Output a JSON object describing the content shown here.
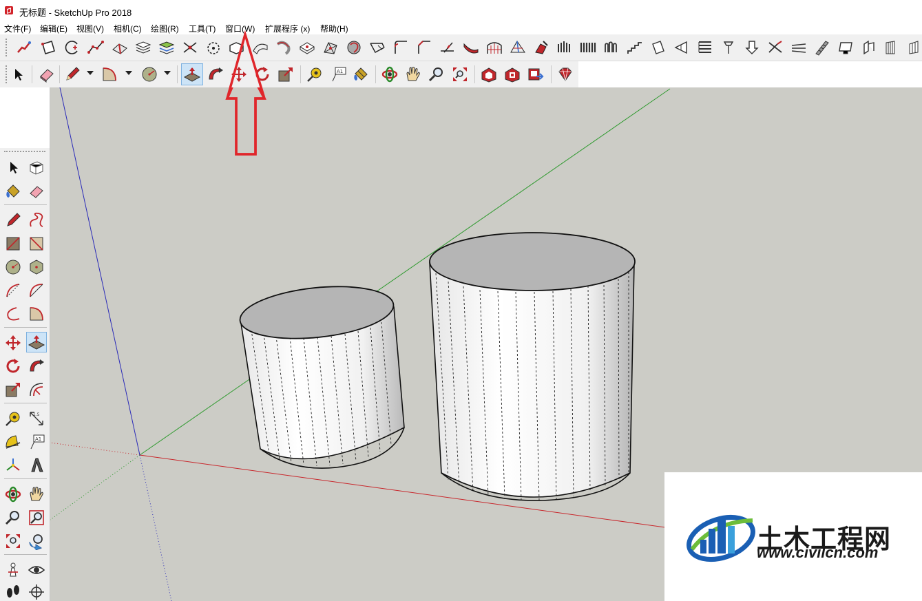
{
  "window": {
    "title": "无标题 - SketchUp Pro 2018",
    "logo_icon": "sketchup-logo-icon"
  },
  "menu": {
    "items": [
      {
        "label": "文件(F)"
      },
      {
        "label": "编辑(E)"
      },
      {
        "label": "视图(V)"
      },
      {
        "label": "相机(C)"
      },
      {
        "label": "绘图(R)"
      },
      {
        "label": "工具(T)"
      },
      {
        "label": "窗口(W)"
      },
      {
        "label": "扩展程序 (x)"
      },
      {
        "label": "帮助(H)"
      }
    ]
  },
  "toolbars": {
    "top_row_icons": [
      "freehand-tool-icon",
      "polygon-tool-icon",
      "circle-plus-icon",
      "polyline-icon",
      "sandbox-icon",
      "layers-icon",
      "layer-manager-icon",
      "intersect-icon",
      "rotate-icon",
      "shape-icon",
      "bend-icon",
      "twist-icon",
      "extrude-icon",
      "subdivide-icon",
      "fillet-icon",
      "round-corner-icon",
      "split-icon",
      "chamfer-icon",
      "curve-icon",
      "pipe-icon",
      "bridge-icon",
      "loft-icon",
      "sweep-icon",
      "face-icon",
      "wall-icon",
      "column-icon",
      "stair-icon",
      "grid-icon",
      "rail-icon",
      "arch-icon",
      "flip-icon",
      "stack-icon",
      "peg-icon",
      "push-icon",
      "trim-icon",
      "extend-icon",
      "roof-icon",
      "cube-icon",
      "tag-icon",
      "ruler-icon"
    ],
    "second_row_icons": [
      "select-icon",
      "eraser-icon",
      "pencil-icon",
      "arc-icon",
      "circle-icon",
      "push-pull-icon",
      "follow-me-icon",
      "move-icon",
      "rotate-tool-icon",
      "scale-icon",
      "tape-measure-icon",
      "text-icon",
      "paint-bucket-icon",
      "orbit-icon",
      "pan-icon",
      "zoom-icon",
      "zoom-extents-icon",
      "warehouse-icon",
      "extension-warehouse-icon",
      "send-to-layout-icon",
      "ruby-icon"
    ],
    "active_tool": "push-pull"
  },
  "annotation": {
    "arrow_color": "#e0262b",
    "points_to": "窗口(W)"
  },
  "left_toolbar": {
    "icons": [
      "select-icon",
      "component-icon",
      "paint-bucket-icon",
      "eraser-icon",
      "pencil-icon",
      "freehand-icon",
      "rectangle-icon",
      "rotated-rectangle-icon",
      "circle-icon",
      "polygon-icon",
      "arc-icon",
      "two-point-arc-icon",
      "three-point-arc-icon",
      "pie-icon",
      "move-icon",
      "push-pull-icon",
      "rotate-icon",
      "follow-me-icon",
      "scale-icon",
      "offset-icon",
      "tape-measure-icon",
      "dimension-icon",
      "protractor-icon",
      "text-icon",
      "axes-icon",
      "3d-text-icon",
      "orbit-icon",
      "pan-icon",
      "zoom-icon",
      "zoom-window-icon",
      "zoom-extents-icon",
      "previous-view-icon",
      "position-camera-icon",
      "look-around-icon",
      "walk-icon",
      "section-plane-icon"
    ]
  },
  "scene": {
    "background": "#ccccc6",
    "axis_colors": {
      "red": "#c8262b",
      "green": "#2f9a2f",
      "blue": "#2a2ab8"
    },
    "objects": [
      "cylinder-small",
      "cylinder-large"
    ]
  },
  "watermark": {
    "title": "土木工程网",
    "url": "www.civilcn.com",
    "logo_colors": [
      "#1a5fb4",
      "#3aa0dc",
      "#6cbd3a"
    ]
  }
}
